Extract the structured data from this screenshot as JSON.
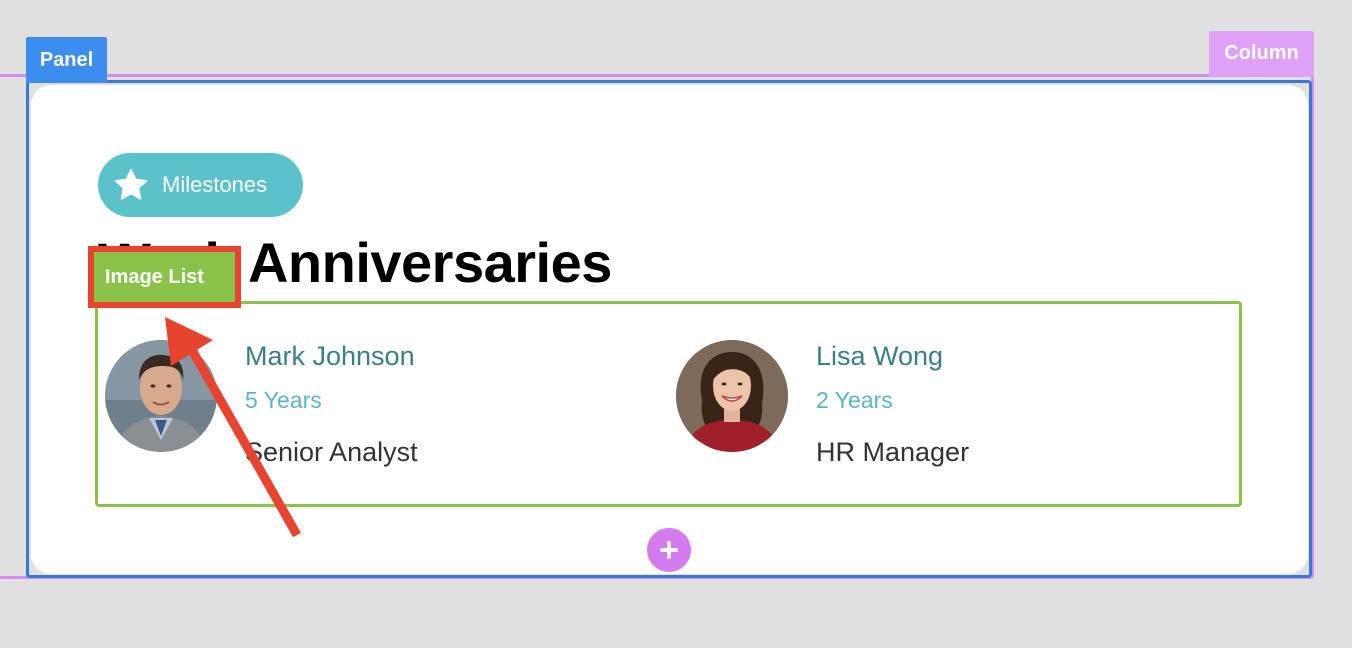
{
  "labels": {
    "panel": "Panel",
    "column": "Column",
    "image_list": "Image List"
  },
  "badge": {
    "label": "Milestones",
    "icon": "star-icon"
  },
  "heading": "Work Anniversaries",
  "people": [
    {
      "name": "Mark Johnson",
      "years": "5 Years",
      "role": "Senior Analyst",
      "avatar": "man-portrait"
    },
    {
      "name": "Lisa Wong",
      "years": "2 Years",
      "role": "HR Manager",
      "avatar": "woman-portrait"
    }
  ],
  "add_button": {
    "icon": "plus-icon"
  },
  "colors": {
    "panel_outline": "#3b78d6",
    "column_outline": "#d58cf2",
    "image_list_outline": "#8bc34a",
    "badge": "#5bc2cc",
    "annotation": "#e8432e",
    "name_text": "#3a7f86",
    "years_text": "#5bb6c0"
  }
}
